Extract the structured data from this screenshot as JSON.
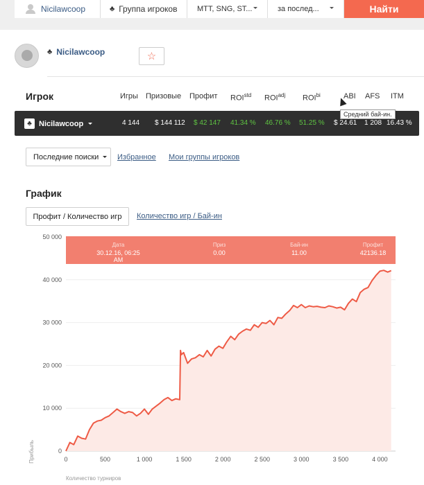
{
  "search": {
    "user_label": "Nicilawcoop",
    "group_label": "Группа игроков",
    "type_value": "MTT, SNG, ST...",
    "period_value": "за послед...",
    "find_label": "Найти"
  },
  "player": {
    "name": "Nicilawcoop",
    "favorite_icon": "☆"
  },
  "stats": {
    "headers": {
      "player": "Игрок",
      "games": "Игры",
      "prizes": "Призовые",
      "profit": "Профит",
      "roi_std": "ROI",
      "roi_std_sup": "std",
      "roi_adj": "ROI",
      "roi_adj_sup": "adj",
      "roi_bi": "ROI",
      "roi_bi_sup": "bi",
      "abi": "ABI",
      "afs": "AFS",
      "itm": "ITM"
    },
    "row": {
      "name": "Nicilawcoop",
      "games": "4 144",
      "prizes": "$ 144 112",
      "profit": "$ 42 147",
      "roi_std": "41.34 %",
      "roi_adj": "46.76 %",
      "roi_bi": "51.25 %",
      "abi": "$ 24.61",
      "afs": "1 208",
      "itm": "16.43 %"
    },
    "tooltip": "Средний бай-ин."
  },
  "filters": {
    "recent_label": "Последние поиски",
    "favorites_label": "Избранное",
    "groups_label": "Мои группы игроков"
  },
  "graph": {
    "title": "График",
    "profit_tab": "Профит / Количество игр",
    "buyin_tab": "Количество игр / Бай-ин",
    "info": {
      "date_label": "Дата",
      "date_value": "30.12.16, 06:25 AM",
      "prize_label": "Приз",
      "prize_value": "0.00",
      "buyin_label": "Бай-ин",
      "buyin_value": "11.00",
      "profit_label": "Профит",
      "profit_value": "42136.18"
    }
  },
  "chart_data": {
    "type": "area",
    "title": "",
    "xlabel": "Количество турниров",
    "ylabel": "Прибыль",
    "xlim": [
      0,
      4200
    ],
    "ylim": [
      0,
      50000
    ],
    "xticks": [
      0,
      500,
      1000,
      1500,
      2000,
      2500,
      3000,
      3500,
      4000
    ],
    "xtick_labels": [
      "0",
      "500",
      "1 000",
      "1 500",
      "2 000",
      "2 500",
      "3 000",
      "3 500",
      "4 000"
    ],
    "yticks": [
      0,
      10000,
      20000,
      30000,
      40000,
      50000
    ],
    "ytick_labels": [
      "0",
      "10 000",
      "20 000",
      "30 000",
      "40 000",
      "50 000"
    ],
    "line_color": "#ee5a45",
    "fill_color": "#fdeae6",
    "x": [
      0,
      50,
      100,
      150,
      200,
      250,
      300,
      350,
      400,
      450,
      500,
      550,
      600,
      650,
      700,
      750,
      800,
      850,
      900,
      950,
      1000,
      1050,
      1100,
      1150,
      1200,
      1250,
      1300,
      1350,
      1400,
      1450,
      1460,
      1470,
      1500,
      1550,
      1600,
      1650,
      1700,
      1750,
      1800,
      1850,
      1900,
      1950,
      2000,
      2050,
      2100,
      2150,
      2200,
      2250,
      2300,
      2350,
      2400,
      2450,
      2500,
      2550,
      2600,
      2650,
      2700,
      2750,
      2800,
      2850,
      2900,
      2950,
      3000,
      3050,
      3100,
      3150,
      3200,
      3250,
      3300,
      3350,
      3400,
      3450,
      3500,
      3550,
      3600,
      3650,
      3700,
      3750,
      3800,
      3850,
      3900,
      3950,
      4000,
      4050,
      4100,
      4144
    ],
    "y": [
      0,
      2000,
      1500,
      3500,
      3000,
      2800,
      5000,
      6500,
      7000,
      7200,
      7800,
      8200,
      9000,
      9800,
      9200,
      8800,
      9200,
      9000,
      8200,
      8800,
      9800,
      8600,
      9800,
      10500,
      11200,
      12000,
      12500,
      11800,
      12200,
      12000,
      23500,
      22500,
      23000,
      20500,
      21500,
      21800,
      22500,
      22000,
      23500,
      22200,
      23800,
      24500,
      24000,
      25500,
      26800,
      26000,
      27300,
      28000,
      28500,
      28200,
      29500,
      28900,
      30000,
      29800,
      30500,
      29500,
      31200,
      31000,
      32000,
      32800,
      34000,
      33500,
      34200,
      33500,
      33900,
      33700,
      33800,
      33600,
      33500,
      33900,
      33700,
      33400,
      33600,
      33000,
      34500,
      35500,
      34900,
      37000,
      37800,
      38200,
      39800,
      41000,
      42000,
      42200,
      41800,
      42136
    ]
  }
}
